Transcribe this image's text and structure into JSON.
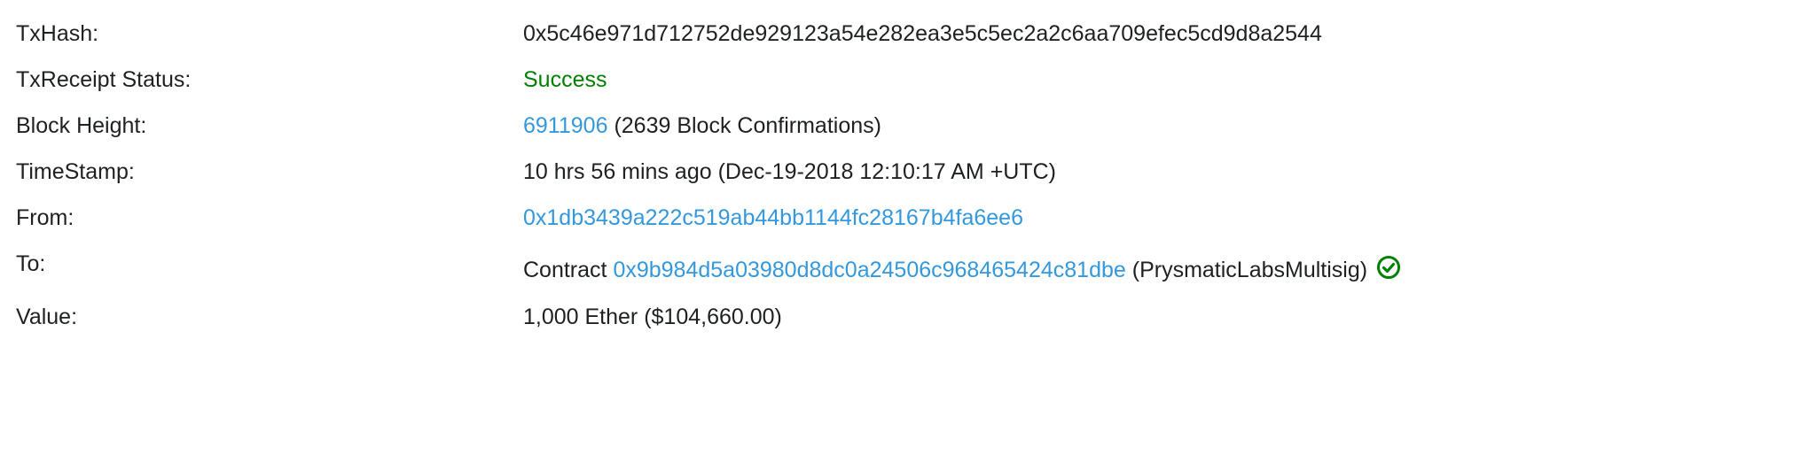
{
  "colors": {
    "link": "#3498db",
    "success": "#008000",
    "text": "#1e2022"
  },
  "tx": {
    "hash_label": "TxHash:",
    "hash": "0x5c46e971d712752de929123a54e282ea3e5c5ec2a2c6aa709efec5cd9d8a2544",
    "status_label": "TxReceipt Status:",
    "status": "Success",
    "block_label": "Block Height:",
    "block_number": "6911906",
    "block_confirmations": "(2639 Block Confirmations)",
    "timestamp_label": "TimeStamp:",
    "timestamp": "10 hrs 56 mins ago (Dec-19-2018 12:10:17 AM +UTC)",
    "from_label": "From:",
    "from_address": "0x1db3439a222c519ab44bb1144fc28167b4fa6ee6",
    "to_label": "To:",
    "to_prefix": "Contract",
    "to_address": "0x9b984d5a03980d8dc0a24506c968465424c81dbe",
    "to_name": "(PrysmaticLabsMultisig)",
    "to_verified_icon": "check-circle-icon",
    "value_label": "Value:",
    "value": "1,000 Ether ($104,660.00)"
  }
}
